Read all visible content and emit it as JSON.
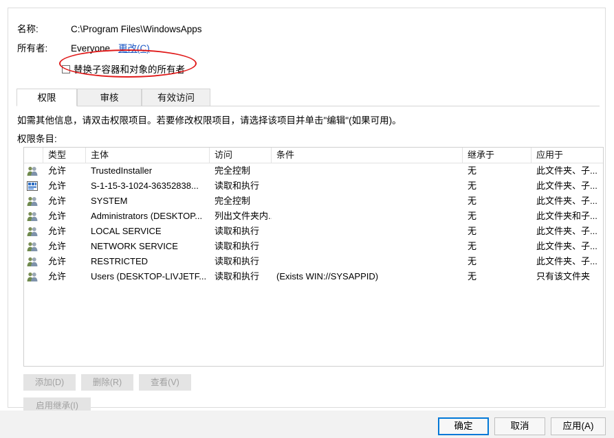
{
  "header": {
    "name_label": "名称:",
    "name_value": "C:\\Program Files\\WindowsApps",
    "owner_label": "所有者:",
    "owner_value": "Everyone",
    "owner_change_link": "更改(C)",
    "replace_owner_checkbox_label": "替换子容器和对象的所有者",
    "replace_owner_checked": false
  },
  "annotation": {
    "shape": "ellipse",
    "color": "#e01b1b",
    "target": "replace-owner-checkbox"
  },
  "tabs": [
    {
      "label": "权限",
      "active": true
    },
    {
      "label": "审核",
      "active": false
    },
    {
      "label": "有效访问",
      "active": false
    }
  ],
  "body": {
    "hint_text": "如需其他信息，请双击权限项目。若要修改权限项目，请选择该项目并单击\"编辑\"(如果可用)。",
    "entries_label": "权限条目:"
  },
  "table": {
    "columns": [
      {
        "key": "icon",
        "label": ""
      },
      {
        "key": "type",
        "label": "类型"
      },
      {
        "key": "principal",
        "label": "主体"
      },
      {
        "key": "access",
        "label": "访问"
      },
      {
        "key": "condition",
        "label": "条件"
      },
      {
        "key": "inherited",
        "label": "继承于"
      },
      {
        "key": "appliesto",
        "label": "应用于"
      }
    ],
    "rows": [
      {
        "icon": "users-group-icon",
        "type": "允许",
        "principal": "TrustedInstaller",
        "access": "完全控制",
        "condition": "",
        "inherited": "无",
        "appliesto": "此文件夹、子..."
      },
      {
        "icon": "app-package-icon",
        "type": "允许",
        "principal": "S-1-15-3-1024-36352838...",
        "access": "读取和执行",
        "condition": "",
        "inherited": "无",
        "appliesto": "此文件夹、子..."
      },
      {
        "icon": "users-group-icon",
        "type": "允许",
        "principal": "SYSTEM",
        "access": "完全控制",
        "condition": "",
        "inherited": "无",
        "appliesto": "此文件夹、子..."
      },
      {
        "icon": "users-group-icon",
        "type": "允许",
        "principal": "Administrators (DESKTOP...",
        "access": "列出文件夹内...",
        "condition": "",
        "inherited": "无",
        "appliesto": "此文件夹和子..."
      },
      {
        "icon": "users-group-icon",
        "type": "允许",
        "principal": "LOCAL SERVICE",
        "access": "读取和执行",
        "condition": "",
        "inherited": "无",
        "appliesto": "此文件夹、子..."
      },
      {
        "icon": "users-group-icon",
        "type": "允许",
        "principal": "NETWORK SERVICE",
        "access": "读取和执行",
        "condition": "",
        "inherited": "无",
        "appliesto": "此文件夹、子..."
      },
      {
        "icon": "users-group-icon",
        "type": "允许",
        "principal": "RESTRICTED",
        "access": "读取和执行",
        "condition": "",
        "inherited": "无",
        "appliesto": "此文件夹、子..."
      },
      {
        "icon": "users-group-icon",
        "type": "允许",
        "principal": "Users (DESKTOP-LIVJETF...",
        "access": "读取和执行",
        "condition": "(Exists WIN://SYSAPPID)",
        "inherited": "无",
        "appliesto": "只有该文件夹"
      }
    ]
  },
  "actions": {
    "add": "添加(D)",
    "remove": "删除(R)",
    "view": "查看(V)",
    "enable_inheritance": "启用继承(I)"
  },
  "footer": {
    "ok": "确定",
    "cancel": "取消",
    "apply": "应用(A)"
  },
  "colors": {
    "link": "#1a57c4",
    "annotation": "#e01b1b",
    "default_button_border": "#0078d7",
    "footer_bg": "#f2f2f2"
  }
}
